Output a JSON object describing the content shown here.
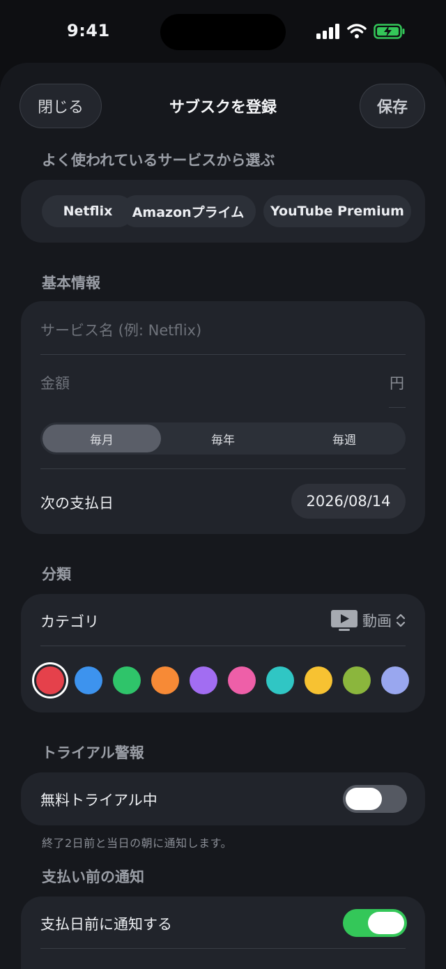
{
  "status_bar": {
    "time": "9:41"
  },
  "header": {
    "close_label": "閉じる",
    "title": "サブスクを登録",
    "save_label": "保存"
  },
  "popular": {
    "label": "よく使われているサービスから選ぶ",
    "chips": [
      "Netflix",
      "Amazonプライム",
      "YouTube Premium"
    ]
  },
  "basic": {
    "label": "基本情報",
    "service_name_placeholder": "サービス名 (例: Netflix)",
    "amount_placeholder": "金額",
    "currency": "円",
    "cycles": [
      "毎月",
      "毎年",
      "毎週"
    ],
    "selected_cycle": "毎月",
    "next_payment_label": "次の支払日",
    "next_payment_date": "2026/08/14"
  },
  "classification": {
    "label": "分類",
    "category_label": "カテゴリ",
    "category_value": "動画",
    "category_icon": "tv-icon",
    "colors": [
      "#e5414b",
      "#3d93ee",
      "#2fc46a",
      "#f78a36",
      "#a26df2",
      "#ee5fa8",
      "#30c6c4",
      "#f7c232",
      "#8bb63d",
      "#99a7ef"
    ],
    "selected_color_index": 0
  },
  "trial": {
    "label": "トライアル警報",
    "toggle_label": "無料トライアル中",
    "enabled": false,
    "note": "終了2日前と当日の朝に通知します。"
  },
  "notify": {
    "label": "支払い前の通知",
    "toggle_label": "支払日前に通知する",
    "enabled": true
  }
}
